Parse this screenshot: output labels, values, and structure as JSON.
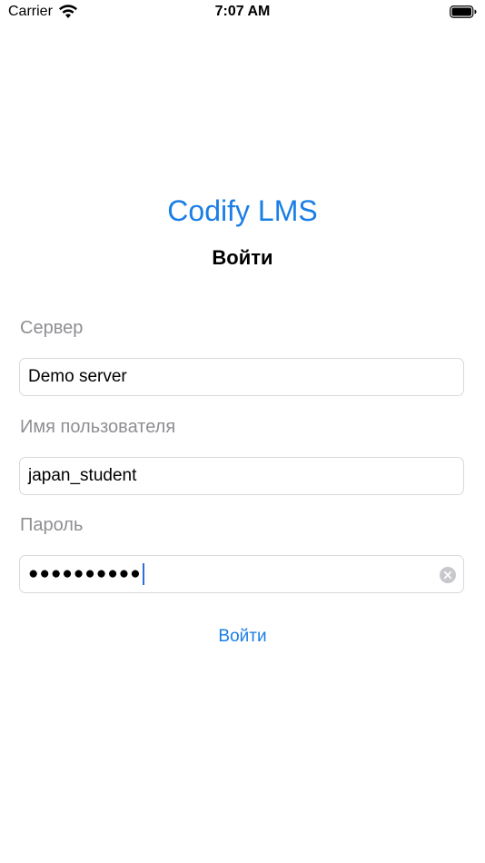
{
  "status_bar": {
    "carrier": "Carrier",
    "time": "7:07 AM",
    "wifi_icon": "wifi-icon",
    "battery_icon": "battery-icon"
  },
  "header": {
    "app_title": "Codify LMS",
    "page_title": "Войти"
  },
  "form": {
    "server": {
      "label": "Сервер",
      "value": "Demo server"
    },
    "username": {
      "label": "Имя пользователя",
      "value": "japan_student"
    },
    "password": {
      "label": "Пароль",
      "masked_value": "●●●●●●●●●●",
      "clear_icon": "clear-icon"
    },
    "submit_label": "Войти"
  },
  "colors": {
    "accent": "#1a7ee6",
    "label_gray": "#8e8e93",
    "border": "#d9d9de",
    "caret": "#2f6fd8"
  }
}
